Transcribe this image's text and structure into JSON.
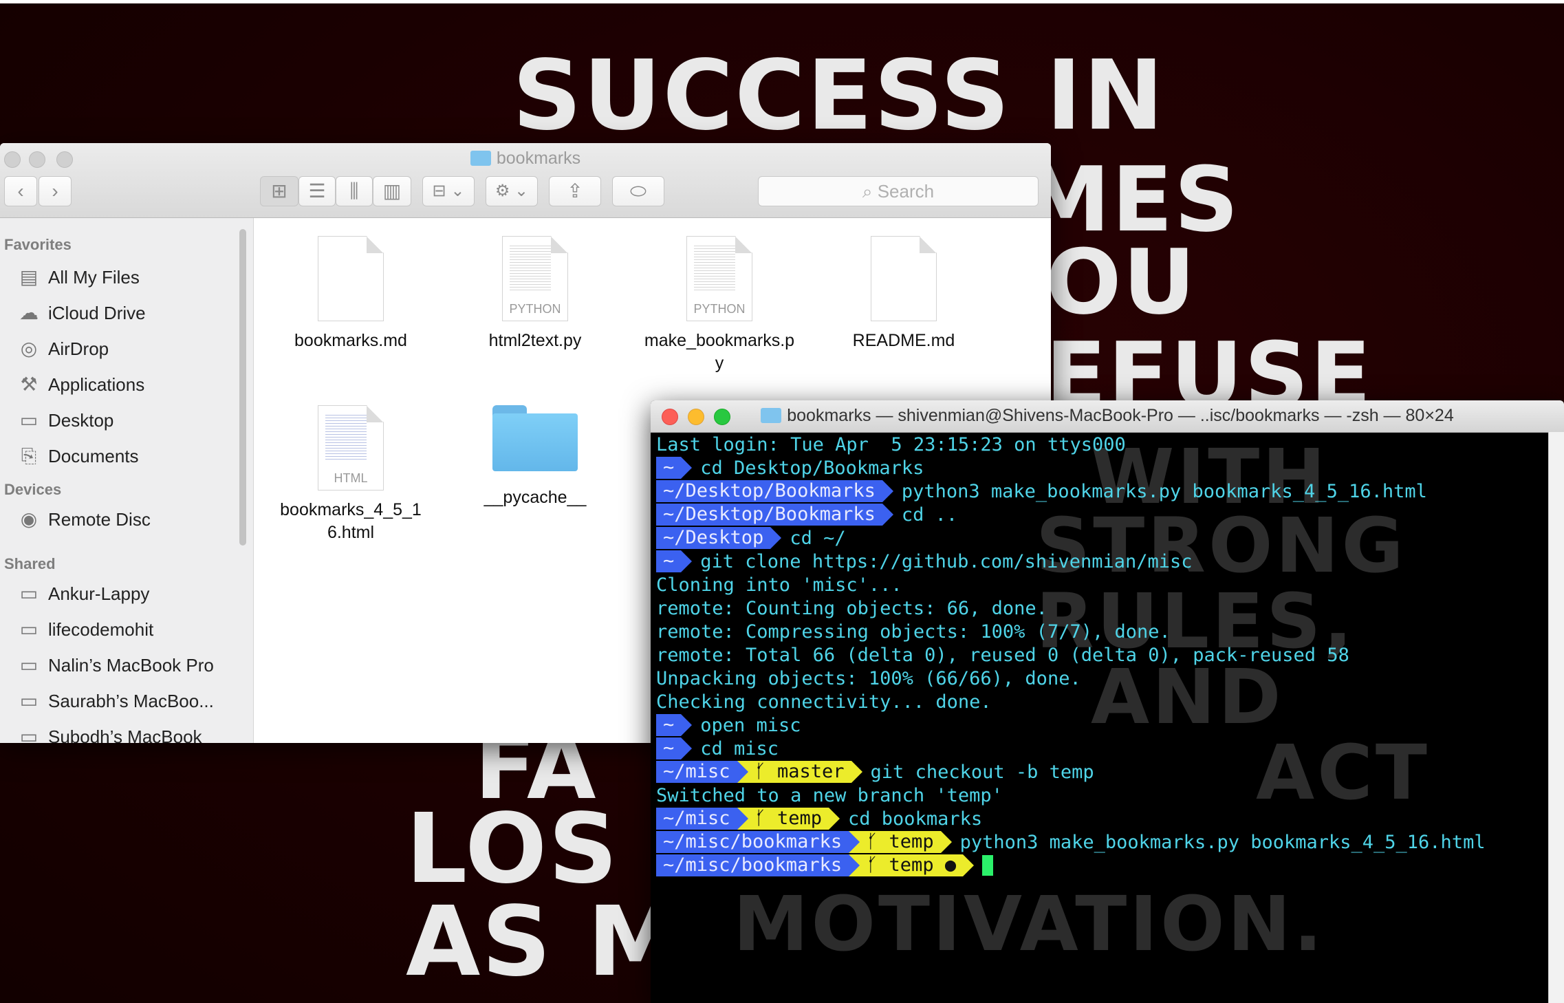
{
  "wallpaper": {
    "big_lines": [
      "SUCCESS IN",
      "MES",
      "OU",
      "EFUSE",
      "FA",
      "LOS",
      "AS M"
    ],
    "small_lines": [
      "WITH",
      "STRONG",
      "RULES,",
      "AND",
      "ACT",
      "MOTIVATION."
    ]
  },
  "finder": {
    "title": "bookmarks",
    "toolbar": {
      "back": "‹",
      "forward": "›",
      "view_icon": "⊞",
      "view_list": "☰",
      "view_column": "⫼",
      "view_cover": "▥",
      "arrange": "⊟ ⌄",
      "action": "⚙ ⌄",
      "share": "⇪",
      "tag": "⬭",
      "search_placeholder": "Search"
    },
    "sidebar": {
      "favorites_header": "Favorites",
      "favorites": [
        {
          "label": "All My Files",
          "icon": "▤"
        },
        {
          "label": "iCloud Drive",
          "icon": "☁"
        },
        {
          "label": "AirDrop",
          "icon": "◎"
        },
        {
          "label": "Applications",
          "icon": "⚒"
        },
        {
          "label": "Desktop",
          "icon": "▭"
        },
        {
          "label": "Documents",
          "icon": "⎘"
        }
      ],
      "devices_header": "Devices",
      "devices": [
        {
          "label": "Remote Disc",
          "icon": "◉"
        }
      ],
      "shared_header": "Shared",
      "shared": [
        {
          "label": "Ankur-Lappy",
          "icon": "▭"
        },
        {
          "label": "lifecodemohit",
          "icon": "▭"
        },
        {
          "label": "Nalin’s MacBook Pro",
          "icon": "▭"
        },
        {
          "label": "Saurabh’s MacBoo...",
          "icon": "▭"
        },
        {
          "label": "Subodh’s MacBook",
          "icon": "▭"
        }
      ]
    },
    "files": [
      {
        "name": "bookmarks.md",
        "tag": ""
      },
      {
        "name": "html2text.py",
        "tag": "PYTHON"
      },
      {
        "name": "make_bookmarks.py",
        "tag": "PYTHON"
      },
      {
        "name": "README.md",
        "tag": ""
      },
      {
        "name": "bookmarks_4_5_16.html",
        "tag": "HTML"
      },
      {
        "name": "__pycache__",
        "tag": ""
      }
    ]
  },
  "terminal": {
    "title": "bookmarks — shivenmian@Shivens-MacBook-Pro — ..isc/bookmarks — -zsh — 80×24",
    "lines": {
      "l1": "Last login: Tue Apr  5 23:15:23 on ttys000",
      "l2_path": "~",
      "l2_cmd": "cd Desktop/Bookmarks",
      "l3_path": "~/Desktop/Bookmarks",
      "l3_cmd": "python3 make_bookmarks.py bookmarks_4_5_16.html",
      "l4_path": "~/Desktop/Bookmarks",
      "l4_cmd": "cd ..",
      "l5_path": "~/Desktop",
      "l5_cmd": "cd ~/",
      "l6_path": "~",
      "l6_cmd": "git clone https://github.com/shivenmian/misc",
      "l7": "Cloning into 'misc'...",
      "l8": "remote: Counting objects: 66, done.",
      "l9": "remote: Compressing objects: 100% (7/7), done.",
      "l10": "remote: Total 66 (delta 0), reused 0 (delta 0), pack-reused 58",
      "l11": "Unpacking objects: 100% (66/66), done.",
      "l12": "Checking connectivity... done.",
      "l13_path": "~",
      "l13_cmd": "open misc",
      "l14_path": "~",
      "l14_cmd": "cd misc",
      "l15_path": "~/misc",
      "l15_branch": "ᚶ master",
      "l15_cmd": "git checkout -b temp",
      "l16": "Switched to a new branch 'temp'",
      "l17_path": "~/misc",
      "l17_branch": "ᚶ temp",
      "l17_cmd": "cd bookmarks",
      "l18_path": "~/misc/bookmarks",
      "l18_branch": "ᚶ temp",
      "l18_cmd": "python3 make_bookmarks.py bookmarks_4_5_16.html",
      "l19_path": "~/misc/bookmarks",
      "l19_branch": "ᚶ temp ●"
    }
  },
  "colors": {
    "prompt_blue": "#3b61f0",
    "prompt_yellow": "#ecec2b",
    "terminal_text": "#4fd4e8",
    "cursor": "#2bf06a",
    "wallpaper": "#1e0001"
  }
}
